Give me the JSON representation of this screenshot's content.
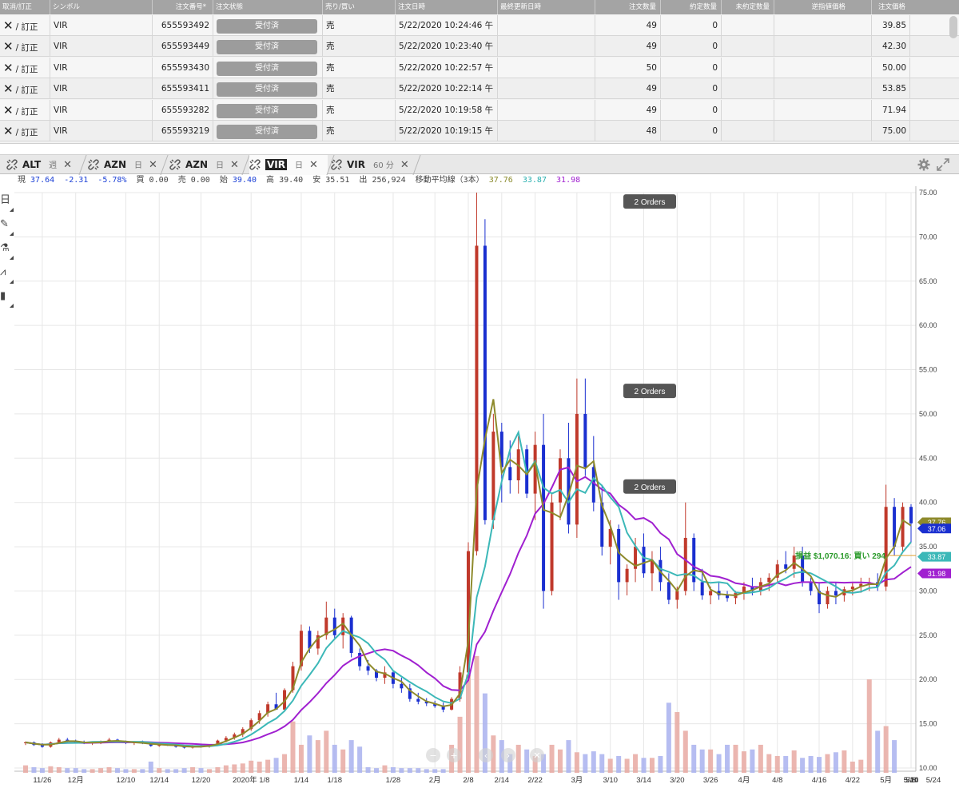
{
  "orders": {
    "headers": [
      "取消/訂正",
      "シンボル",
      "注文番号*",
      "注文状態",
      "売り/買い",
      "注文日時",
      "最終更新日時",
      "注文数量",
      "約定数量",
      "未約定数量",
      "逆指値価格",
      "注文価格"
    ],
    "cancel_icon": "close-icon",
    "cancel_label": "/ 訂正",
    "rows": [
      {
        "symbol": "VIR",
        "order_no": "655593492",
        "status": "受付済",
        "side": "売",
        "datetime": "5/22/2020 10:24:46 午",
        "updated": "",
        "qty": "49",
        "filled": "0",
        "unfilled": "",
        "stop": "",
        "price": "39.85"
      },
      {
        "symbol": "VIR",
        "order_no": "655593449",
        "status": "受付済",
        "side": "売",
        "datetime": "5/22/2020 10:23:40 午",
        "updated": "",
        "qty": "49",
        "filled": "0",
        "unfilled": "",
        "stop": "",
        "price": "42.30"
      },
      {
        "symbol": "VIR",
        "order_no": "655593430",
        "status": "受付済",
        "side": "売",
        "datetime": "5/22/2020 10:22:57 午",
        "updated": "",
        "qty": "50",
        "filled": "0",
        "unfilled": "",
        "stop": "",
        "price": "50.00"
      },
      {
        "symbol": "VIR",
        "order_no": "655593411",
        "status": "受付済",
        "side": "売",
        "datetime": "5/22/2020 10:22:14 午",
        "updated": "",
        "qty": "49",
        "filled": "0",
        "unfilled": "",
        "stop": "",
        "price": "53.85"
      },
      {
        "symbol": "VIR",
        "order_no": "655593282",
        "status": "受付済",
        "side": "売",
        "datetime": "5/22/2020 10:19:58 午",
        "updated": "",
        "qty": "49",
        "filled": "0",
        "unfilled": "",
        "stop": "",
        "price": "71.94"
      },
      {
        "symbol": "VIR",
        "order_no": "655593219",
        "status": "受付済",
        "side": "売",
        "datetime": "5/22/2020 10:19:15 午",
        "updated": "",
        "qty": "48",
        "filled": "0",
        "unfilled": "",
        "stop": "",
        "price": "75.00"
      }
    ]
  },
  "tabs": [
    {
      "symbol": "ALT",
      "timeframe": "週"
    },
    {
      "symbol": "AZN",
      "timeframe": "日"
    },
    {
      "symbol": "AZN",
      "timeframe": "日"
    },
    {
      "symbol": "VIR",
      "timeframe": "日",
      "active": true
    },
    {
      "symbol": "VIR",
      "timeframe": "60 分"
    }
  ],
  "tab_close": "✕",
  "quote": {
    "last_label": "現",
    "last": "37.64",
    "change": "-2.31",
    "change_pct": "-5.78%",
    "bid_label": "買",
    "bid": "0.00",
    "ask_label": "売",
    "ask": "0.00",
    "open_label": "始",
    "open": "39.40",
    "high_label": "高",
    "high": "39.40",
    "low_label": "安",
    "low": "35.51",
    "volume_label": "出",
    "volume": "256,924",
    "ma_label": "移動平均線（3本）",
    "ma1": "37.76",
    "ma2": "33.87",
    "ma3": "31.98"
  },
  "toolbar_icons": [
    "calendar-icon",
    "draw-icon",
    "flask-icon",
    "wave-icon",
    "bars-icon"
  ],
  "toolbar_glyphs": [
    "日",
    "✎",
    "⚗",
    "⩘",
    "▮"
  ],
  "chart_data": {
    "type": "candlestick",
    "y_axis": {
      "min": 10,
      "max": 75,
      "ticks": [
        "75.00",
        "70.00",
        "65.00",
        "60.00",
        "55.00",
        "50.00",
        "45.00",
        "40.00",
        "35.00",
        "30.00",
        "25.00",
        "20.00",
        "15.00",
        "10.00"
      ]
    },
    "x_labels": [
      "11/26",
      "12月",
      "12/10",
      "12/14",
      "12/20",
      "2020年 1/8",
      "1/14",
      "1/18",
      "1/28",
      "2月",
      "2/8",
      "2/14",
      "2/22",
      "3月",
      "3/10",
      "3/14",
      "3/20",
      "3/26",
      "4月",
      "4/8",
      "4/16",
      "4/22",
      "5月",
      "5/8",
      "5/14",
      "5/20",
      "5/24"
    ],
    "candles": [
      [
        12.8,
        13.0,
        12.6,
        12.9
      ],
      [
        12.9,
        13.0,
        12.5,
        12.6
      ],
      [
        12.6,
        12.8,
        12.3,
        12.4
      ],
      [
        12.4,
        13.0,
        12.3,
        12.9
      ],
      [
        12.9,
        13.4,
        12.8,
        13.2
      ],
      [
        13.2,
        13.4,
        12.9,
        13.0
      ],
      [
        13.0,
        13.2,
        12.8,
        12.9
      ],
      [
        12.9,
        13.1,
        12.7,
        12.8
      ],
      [
        12.8,
        13.0,
        12.6,
        12.9
      ],
      [
        12.9,
        13.1,
        12.7,
        13.0
      ],
      [
        13.0,
        13.4,
        12.9,
        13.2
      ],
      [
        13.2,
        13.3,
        12.9,
        13.0
      ],
      [
        13.0,
        13.1,
        12.7,
        12.8
      ],
      [
        12.8,
        13.0,
        12.6,
        12.9
      ],
      [
        12.9,
        13.1,
        12.7,
        12.8
      ],
      [
        12.8,
        12.9,
        12.4,
        12.5
      ],
      [
        12.5,
        12.8,
        12.4,
        12.7
      ],
      [
        12.7,
        12.9,
        12.5,
        12.6
      ],
      [
        12.6,
        12.8,
        12.3,
        12.4
      ],
      [
        12.4,
        12.6,
        12.2,
        12.3
      ],
      [
        12.3,
        12.6,
        12.2,
        12.5
      ],
      [
        12.5,
        12.7,
        12.3,
        12.4
      ],
      [
        12.4,
        12.7,
        12.3,
        12.6
      ],
      [
        12.6,
        13.2,
        12.5,
        13.1
      ],
      [
        13.1,
        13.6,
        12.9,
        13.4
      ],
      [
        13.4,
        14.0,
        13.2,
        13.8
      ],
      [
        13.8,
        14.6,
        13.5,
        14.4
      ],
      [
        14.4,
        15.6,
        14.2,
        15.4
      ],
      [
        15.4,
        16.5,
        15.0,
        16.2
      ],
      [
        16.2,
        17.5,
        15.8,
        17.2
      ],
      [
        17.2,
        18.5,
        16.8,
        16.6
      ],
      [
        16.6,
        19.0,
        16.4,
        18.8
      ],
      [
        18.8,
        22.0,
        18.5,
        21.5
      ],
      [
        21.5,
        26.2,
        21.0,
        25.5
      ],
      [
        25.5,
        26.0,
        23.0,
        23.5
      ],
      [
        23.5,
        25.5,
        22.8,
        25.0
      ],
      [
        25.0,
        28.8,
        24.5,
        27.0
      ],
      [
        27.0,
        28.0,
        24.5,
        25.0
      ],
      [
        25.0,
        27.5,
        23.5,
        27.0
      ],
      [
        27.0,
        27.2,
        22.5,
        23.0
      ],
      [
        23.0,
        23.5,
        21.0,
        21.5
      ],
      [
        21.5,
        22.2,
        20.5,
        21.0
      ],
      [
        21.0,
        21.2,
        19.8,
        20.2
      ],
      [
        20.2,
        21.5,
        19.5,
        20.8
      ],
      [
        20.8,
        21.0,
        19.0,
        19.5
      ],
      [
        19.5,
        20.2,
        18.5,
        19.0
      ],
      [
        19.0,
        19.5,
        17.5,
        17.8
      ],
      [
        17.8,
        18.5,
        17.2,
        17.5
      ],
      [
        17.5,
        17.9,
        17.0,
        17.3
      ],
      [
        17.3,
        17.6,
        16.8,
        17.0
      ],
      [
        17.0,
        17.4,
        16.3,
        16.6
      ],
      [
        16.6,
        18.0,
        16.5,
        17.8
      ],
      [
        17.8,
        21.5,
        17.5,
        20.8
      ],
      [
        20.8,
        35.5,
        20.0,
        34.5
      ],
      [
        34.5,
        75.0,
        34.0,
        69.0
      ],
      [
        69.0,
        72.0,
        37.5,
        38.0
      ],
      [
        38.0,
        50.0,
        37.0,
        48.0
      ],
      [
        48.0,
        49.0,
        40.0,
        44.0
      ],
      [
        44.0,
        47.0,
        41.0,
        42.5
      ],
      [
        42.5,
        47.5,
        41.0,
        46.0
      ],
      [
        46.0,
        46.5,
        40.5,
        41.0
      ],
      [
        41.0,
        48.0,
        38.0,
        46.5
      ],
      [
        46.5,
        50.0,
        28.0,
        30.0
      ],
      [
        30.0,
        41.0,
        29.5,
        40.0
      ],
      [
        40.0,
        46.0,
        38.0,
        45.0
      ],
      [
        45.0,
        49.0,
        36.5,
        37.5
      ],
      [
        37.5,
        54.0,
        36.0,
        50.0
      ],
      [
        50.0,
        54.0,
        43.0,
        44.0
      ],
      [
        44.0,
        47.5,
        39.0,
        40.0
      ],
      [
        40.0,
        42.0,
        34.0,
        35.0
      ],
      [
        35.0,
        38.0,
        33.0,
        37.0
      ],
      [
        37.0,
        37.5,
        29.0,
        31.0
      ],
      [
        31.0,
        33.0,
        29.5,
        32.5
      ],
      [
        32.5,
        36.0,
        31.0,
        35.0
      ],
      [
        35.0,
        36.5,
        31.5,
        32.0
      ],
      [
        32.0,
        34.5,
        30.0,
        33.5
      ],
      [
        33.5,
        35.0,
        30.0,
        31.0
      ],
      [
        31.0,
        32.0,
        28.5,
        29.0
      ],
      [
        29.0,
        30.5,
        28.0,
        30.0
      ],
      [
        30.0,
        40.0,
        29.5,
        36.0
      ],
      [
        36.0,
        36.5,
        30.0,
        31.0
      ],
      [
        31.0,
        32.5,
        29.0,
        29.5
      ],
      [
        29.5,
        30.5,
        28.5,
        30.0
      ],
      [
        30.0,
        31.0,
        29.0,
        29.5
      ],
      [
        29.5,
        30.0,
        28.8,
        29.2
      ],
      [
        29.2,
        30.0,
        28.5,
        29.8
      ],
      [
        29.8,
        31.0,
        29.0,
        30.5
      ],
      [
        30.5,
        31.5,
        29.5,
        30.0
      ],
      [
        30.0,
        31.5,
        29.5,
        31.0
      ],
      [
        31.0,
        32.0,
        30.0,
        31.5
      ],
      [
        31.5,
        33.5,
        31.0,
        33.0
      ],
      [
        33.0,
        34.5,
        32.0,
        32.5
      ],
      [
        32.5,
        35.0,
        31.5,
        34.0
      ],
      [
        34.0,
        35.0,
        30.5,
        31.0
      ],
      [
        31.0,
        31.5,
        29.5,
        30.0
      ],
      [
        30.0,
        31.0,
        27.5,
        28.5
      ],
      [
        28.5,
        30.5,
        28.0,
        30.0
      ],
      [
        30.0,
        31.0,
        28.5,
        29.5
      ],
      [
        29.5,
        30.5,
        28.8,
        30.2
      ],
      [
        30.2,
        31.0,
        29.5,
        30.5
      ],
      [
        30.5,
        31.5,
        29.8,
        30.8
      ],
      [
        30.8,
        31.5,
        30.0,
        31.0
      ],
      [
        31.0,
        32.0,
        30.0,
        30.5
      ],
      [
        30.5,
        42.0,
        30.0,
        39.5
      ],
      [
        39.5,
        40.5,
        34.0,
        35.0
      ],
      [
        35.0,
        40.0,
        34.5,
        39.5
      ],
      [
        39.5,
        39.8,
        35.5,
        37.64
      ]
    ],
    "volume": [
      0.8,
      0.6,
      0.5,
      0.7,
      0.6,
      0.5,
      0.5,
      0.4,
      0.4,
      0.5,
      0.6,
      0.5,
      0.4,
      0.4,
      0.4,
      1.2,
      0.5,
      0.4,
      0.4,
      0.5,
      0.6,
      0.5,
      0.4,
      0.6,
      0.8,
      0.9,
      1.0,
      1.3,
      1.2,
      1.4,
      1.6,
      2.0,
      5.5,
      3.0,
      4.0,
      3.5,
      4.5,
      3.0,
      2.5,
      3.5,
      2.8,
      0.6,
      0.5,
      0.8,
      0.6,
      0.5,
      0.5,
      0.5,
      0.4,
      0.4,
      0.4,
      3.0,
      6.0,
      10.5,
      12.5,
      8.5,
      4.0,
      3.5,
      2.0,
      3.0,
      2.5,
      1.8,
      2.0,
      3.0,
      2.5,
      3.5,
      2.2,
      2.0,
      2.3,
      2.0,
      1.5,
      1.8,
      1.5,
      2.0,
      1.6,
      1.6,
      1.8,
      7.5,
      6.5,
      4.5,
      3.0,
      2.5,
      2.5,
      2.0,
      3.0,
      3.0,
      2.3,
      2.5,
      3.0,
      2.0,
      1.8,
      1.8,
      2.4,
      1.6,
      1.8,
      1.7,
      2.0,
      2.2,
      2.4,
      1.2,
      1.4,
      10.0,
      4.5,
      5.0,
      3.5
    ],
    "moving_averages": [
      {
        "period": 3,
        "color": "#8e8a2c",
        "value": "37.76"
      },
      {
        "period": 3,
        "color": "#3cb8b8",
        "value": "33.87"
      },
      {
        "period": 3,
        "color": "#a020d0",
        "value": "31.98"
      }
    ],
    "order_markers": [
      {
        "label": "2 Orders",
        "price": 74.0
      },
      {
        "label": "2 Orders",
        "price": 52.6
      },
      {
        "label": "2 Orders",
        "price": 41.8
      }
    ],
    "position_line": {
      "label": "損益 $1,070.16: 買い 294",
      "price": 34.0
    },
    "price_tags": [
      {
        "label": "37.76",
        "price": 37.76,
        "color": "#8e8a2c"
      },
      {
        "label": "37.06",
        "price": 37.06,
        "color": "#1a2fd0"
      },
      {
        "label": "33.87",
        "price": 33.87,
        "color": "#3cb8b8"
      },
      {
        "label": "31.98",
        "price": 31.98,
        "color": "#a020d0"
      }
    ],
    "colors": {
      "up": "#c0392b",
      "down": "#1a2fd0",
      "grid": "#e7e7e7"
    }
  }
}
